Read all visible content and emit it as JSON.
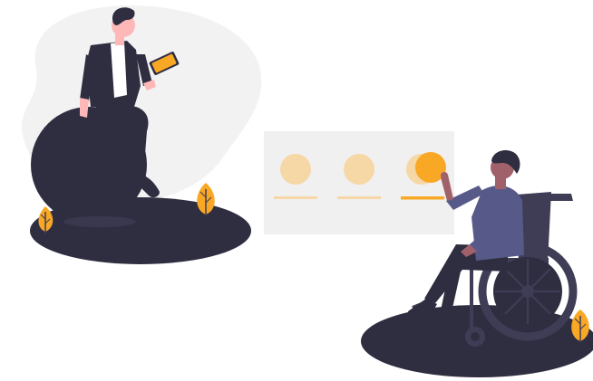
{
  "colors": {
    "dark": "#3f3d56",
    "dark_deep": "#2f2e41",
    "accent": "#f9a826",
    "accent_light": "#f6d7a6",
    "blob": "#f2f2f2",
    "card": "#f0f0f0",
    "skin_light": "#ffb8b8",
    "skin_dark": "#a0616a",
    "shirt_blue": "#575a89",
    "white": "#ffffff"
  },
  "icons": {
    "plant": "leaf-bush-icon",
    "phone": "smartphone-icon"
  },
  "selector_card": {
    "options_count": 3,
    "selected_index": 2
  }
}
